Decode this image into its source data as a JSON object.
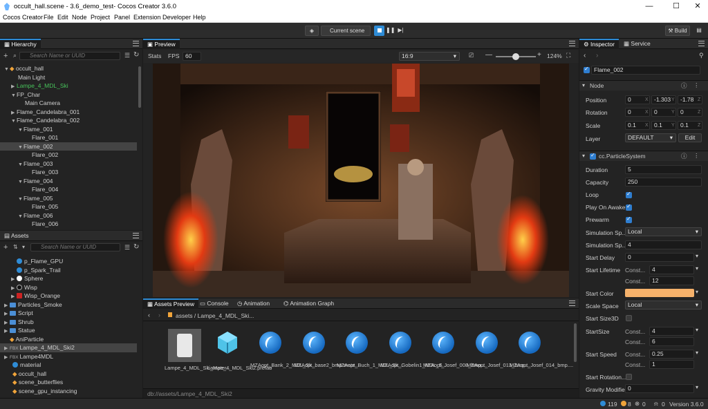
{
  "window": {
    "title": "occult_hall.scene - 3.6_demo_test- Cocos Creator 3.6.0"
  },
  "menu": [
    "Cocos Creator",
    "File",
    "Edit",
    "Node",
    "Project",
    "Panel",
    "Extension",
    "Developer",
    "Help"
  ],
  "toolbar": {
    "scene_select": "Current scene",
    "build_label": "Build"
  },
  "hierarchy": {
    "tab": "Hierarchy",
    "search_placeholder": "Search Name or UUID",
    "rows": [
      "occult_hall",
      "Main Light",
      "Lampe_4_MDL_Ski",
      "FP_Char",
      "Main Camera",
      "Flame_Candelabra_001",
      "Flame_Candelabra_002",
      "Flame_001",
      "Flare_001",
      "Flame_002",
      "Flare_002",
      "Flame_003",
      "Flare_003",
      "Flame_004",
      "Flare_004",
      "Flame_005",
      "Flare_005",
      "Flame_006",
      "Flare_006"
    ]
  },
  "assets": {
    "tab": "Assets",
    "search_placeholder": "Search Name or UUID",
    "rows": [
      "p_Flame_GPU",
      "p_Spark_Trail",
      "Sphere",
      "Wisp",
      "Wisp_Orange",
      "Particles_Smoke",
      "Script",
      "Shrub",
      "Statue",
      "AniParticle",
      "Lampe_4_MDL_Ski2",
      "Lampe4MDL",
      "material",
      "occult_hall",
      "scene_butterflies",
      "scene_gpu_instancing"
    ]
  },
  "preview": {
    "tab": "Preview",
    "stats_label": "Stats",
    "fps_label": "FPS",
    "fps_value": "60",
    "aspect": "16:9",
    "zoom": "124%"
  },
  "bottom_tabs": [
    "Assets Preview",
    "Console",
    "Animation",
    "Animation Graph"
  ],
  "assets_preview": {
    "breadcrumb": "assets / Lampe_4_MDL_Ski...",
    "path": "db://assets/Lampe_4_MDL_Ski2",
    "items": [
      "Lampe_4_MDL_Ski_Mater...",
      "Lampe_4_MDL_Ski2.prefab",
      "MZAopt_Bank_2_MDL_Sk...",
      "MZAopt_base2_bmp.mate...",
      "MZAopt_Buch_1_MDL_Sk...",
      "MZAopt_Gobelin1_MDL_S...",
      "MZAopt_Josef_008_bmp....",
      "MZAopt_Josef_013_bmp....",
      "MZAopt_Josef_014_bmp...."
    ]
  },
  "inspector": {
    "tab": "Inspector",
    "tab2": "Service",
    "node_name": "Flame_002",
    "node_section": "Node",
    "position": [
      "0",
      "-1.303",
      "-1.78"
    ],
    "rotation": [
      "0",
      "0",
      "0"
    ],
    "scale": [
      "0.1",
      "0.1",
      "0.1"
    ],
    "layer": "DEFAULT",
    "edit_label": "Edit",
    "component": "cc.ParticleSystem",
    "labels": {
      "position": "Position",
      "rotation": "Rotation",
      "scale": "Scale",
      "layer": "Layer",
      "duration": "Duration",
      "capacity": "Capacity",
      "loop": "Loop",
      "play_on_awake": "Play On Awake",
      "prewarm": "Prewarm",
      "sim_space": "Simulation Sp...",
      "sim_speed": "Simulation Sp...",
      "start_delay": "Start Delay",
      "start_lifetime": "Start Lifetime",
      "start_color": "Start Color",
      "scale_space": "Scale Space",
      "start_size_3d": "Start Size3D",
      "start_size": "StartSize",
      "start_speed": "Start Speed",
      "start_rotation": "Start Rotation...",
      "gravity": "Gravity Modifier"
    },
    "duration": "5",
    "capacity": "250",
    "sim_space_value": "Local",
    "sim_speed_value": "4",
    "start_delay": "0",
    "const_label": "Const...",
    "lifetime": [
      "4",
      "12"
    ],
    "scale_space_value": "Local",
    "start_size": [
      "4",
      "6"
    ],
    "start_speed": [
      "0.25",
      "1"
    ],
    "gravity": "0",
    "start_color_hex": "#f5b16b"
  },
  "status": {
    "info": "119",
    "warn": "8",
    "error": "0",
    "misc": "0",
    "version": "Version 3.6.0"
  },
  "colors": {
    "accent": "#2f8cd6",
    "panel": "#232323"
  }
}
